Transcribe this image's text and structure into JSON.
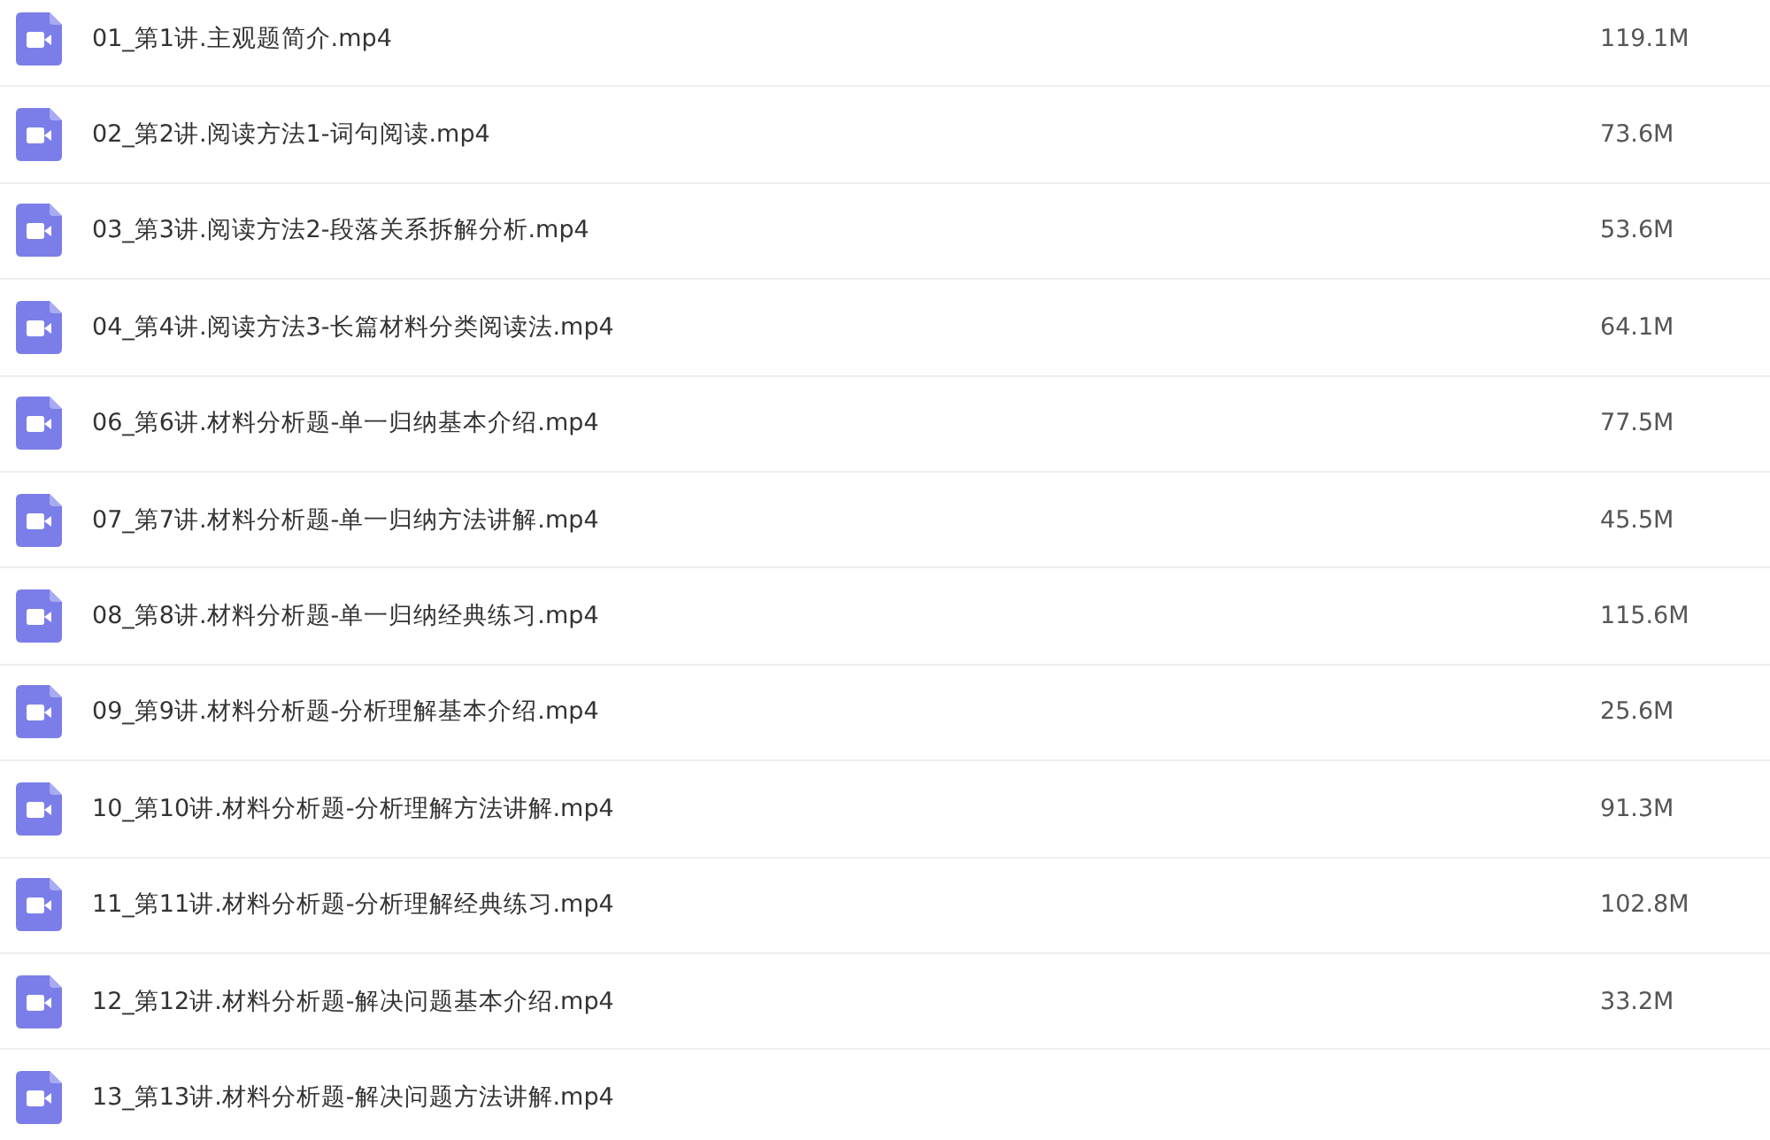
{
  "files": [
    {
      "name": "01_第1讲.主观题简介.mp4",
      "size": "119.1M"
    },
    {
      "name": "02_第2讲.阅读方法1-词句阅读.mp4",
      "size": "73.6M"
    },
    {
      "name": "03_第3讲.阅读方法2-段落关系拆解分析.mp4",
      "size": "53.6M"
    },
    {
      "name": "04_第4讲.阅读方法3-长篇材料分类阅读法.mp4",
      "size": "64.1M"
    },
    {
      "name": "06_第6讲.材料分析题-单一归纳基本介绍.mp4",
      "size": "77.5M"
    },
    {
      "name": "07_第7讲.材料分析题-单一归纳方法讲解.mp4",
      "size": "45.5M"
    },
    {
      "name": "08_第8讲.材料分析题-单一归纳经典练习.mp4",
      "size": "115.6M"
    },
    {
      "name": "09_第9讲.材料分析题-分析理解基本介绍.mp4",
      "size": "25.6M"
    },
    {
      "name": "10_第10讲.材料分析题-分析理解方法讲解.mp4",
      "size": "91.3M"
    },
    {
      "name": "11_第11讲.材料分析题-分析理解经典练习.mp4",
      "size": "102.8M"
    },
    {
      "name": "12_第12讲.材料分析题-解决问题基本介绍.mp4",
      "size": "33.2M"
    },
    {
      "name": "13_第13讲.材料分析题-解决问题方法讲解.mp4"
    }
  ]
}
